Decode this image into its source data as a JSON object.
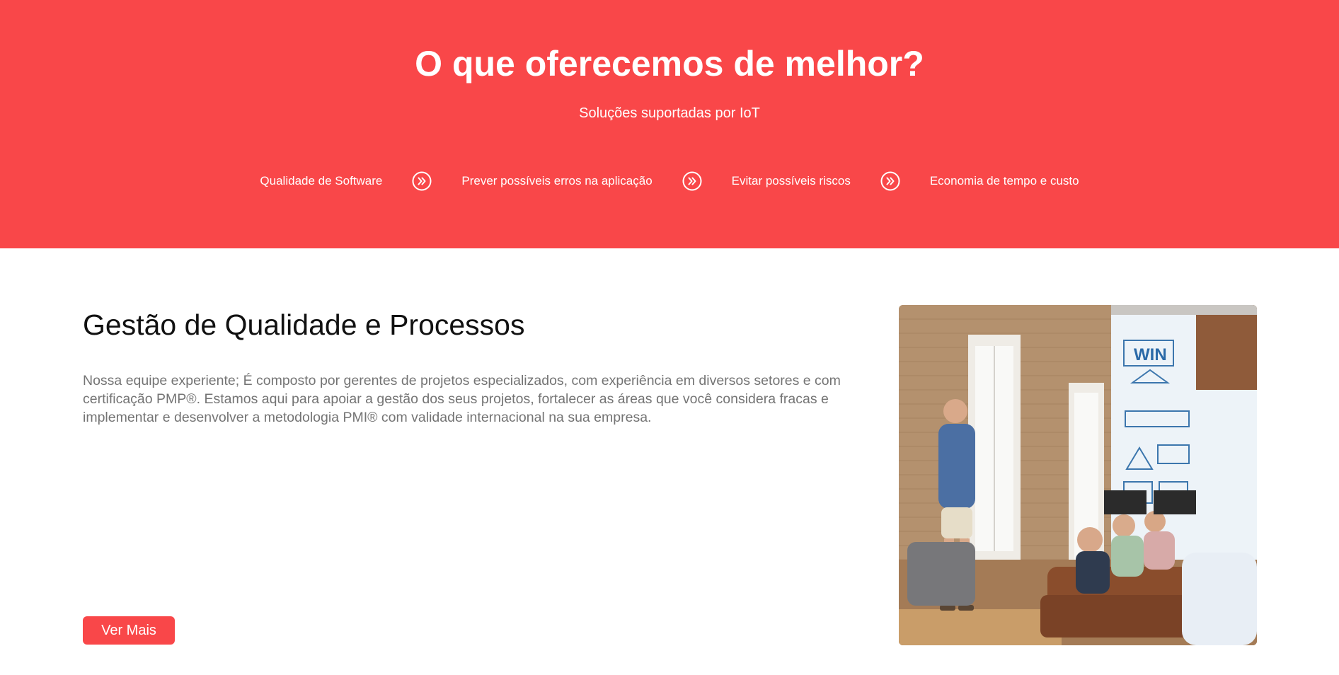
{
  "hero": {
    "title": "O que oferecemos de melhor?",
    "subtitle": "Soluções suportadas por IoT",
    "background_color": "#f94749",
    "features": [
      "Qualidade de Software",
      "Prever possíveis erros na aplicação",
      "Evitar possíveis riscos",
      "Economia de tempo e custo"
    ],
    "separator_icon": "double-chevron-right-circle-icon"
  },
  "section": {
    "title": "Gestão de Qualidade e Processos",
    "description": "Nossa equipe experiente; É composto por gerentes de projetos especializados, com experiência em diversos setores e com certificação PMP®. Estamos aqui para apoiar a gestão dos seus projetos, fortalecer as áreas que você considera fracas e implementar e desenvolver a metodologia PMI® com validade internacional na sua empresa.",
    "button_label": "Ver Mais",
    "accent_color": "#f94749",
    "image_alt": "team-meeting-photo"
  }
}
